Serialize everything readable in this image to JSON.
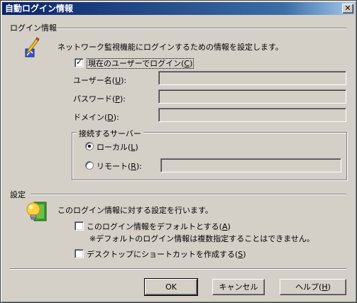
{
  "window": {
    "title": "自動ログイン情報"
  },
  "login_group": {
    "title": "ログイン情報",
    "description": "ネットワーク監視機能にログインするための情報を設定します。",
    "icon": "pencil-document-icon",
    "use_current_user": {
      "label": "現在のユーザーでログイン(",
      "mnemonic": "C",
      "suffix": ")",
      "checked": true
    },
    "username": {
      "label": "ユーザー名(",
      "mnemonic": "U",
      "suffix": "):",
      "value": ""
    },
    "password": {
      "label": "パスワード(",
      "mnemonic": "P",
      "suffix": "):",
      "value": ""
    },
    "domain": {
      "label": "ドメイン(",
      "mnemonic": "D",
      "suffix": "):",
      "value": ""
    },
    "server_group": {
      "title": "接続するサーバー",
      "local": {
        "label": "ローカル(",
        "mnemonic": "L",
        "suffix": ")",
        "checked": true
      },
      "remote": {
        "label": "リモート(",
        "mnemonic": "R",
        "suffix": "):",
        "checked": false,
        "value": ""
      }
    }
  },
  "settings_group": {
    "title": "設定",
    "description": "このログイン情報に対する設定を行います。",
    "icon": "lightbulb-icon",
    "default_checkbox": {
      "label": "このログイン情報をデフォルトとする(",
      "mnemonic": "A",
      "suffix": ")",
      "checked": false
    },
    "default_note": "※デフォルトのログイン情報は複数指定することはできません。",
    "shortcut_checkbox": {
      "label": "デスクトップにショートカットを作成する(",
      "mnemonic": "S",
      "suffix": ")",
      "checked": false
    }
  },
  "buttons": {
    "ok": "OK",
    "cancel": "キャンセル",
    "help": {
      "label": "ヘルプ(",
      "mnemonic": "H",
      "suffix": ")"
    }
  }
}
